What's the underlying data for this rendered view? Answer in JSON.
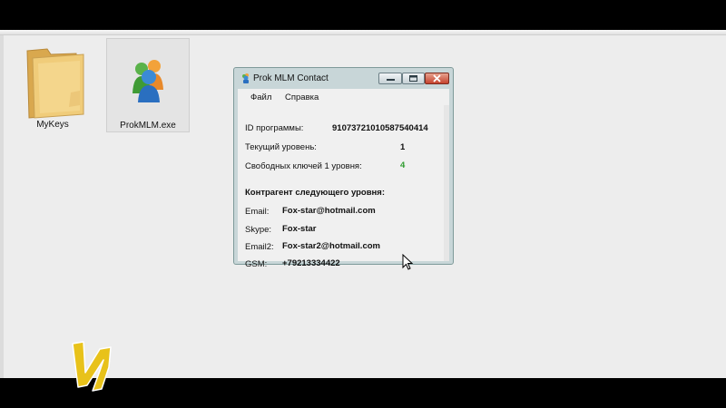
{
  "desktop": {
    "icons": [
      {
        "name": "MyKeys",
        "type": "folder"
      },
      {
        "name": "ProkMLM.exe",
        "type": "application"
      }
    ]
  },
  "window": {
    "title": "Prok MLM Contact",
    "menu": [
      "Файл",
      "Справка"
    ],
    "fields": {
      "program_id_label": "ID программы:",
      "program_id_value": "91073721010587540414",
      "level_label": "Текущий уровень:",
      "level_value": "1",
      "free_keys_label": "Свободных ключей 1 уровня:",
      "free_keys_value": "4"
    },
    "contact": {
      "header": "Контрагент следующего уровня:",
      "email_label": "Email:",
      "email_value": "Fox-star@hotmail.com",
      "skype_label": "Skype:",
      "skype_value": "Fox-star",
      "email2_label": "Email2:",
      "email2_value": "Fox-star2@hotmail.com",
      "gsm_label": "GSM:",
      "gsm_value": "+79213334422"
    }
  },
  "colors": {
    "free_keys_value": "#2e9b2e",
    "logo": "#e8c21a"
  }
}
